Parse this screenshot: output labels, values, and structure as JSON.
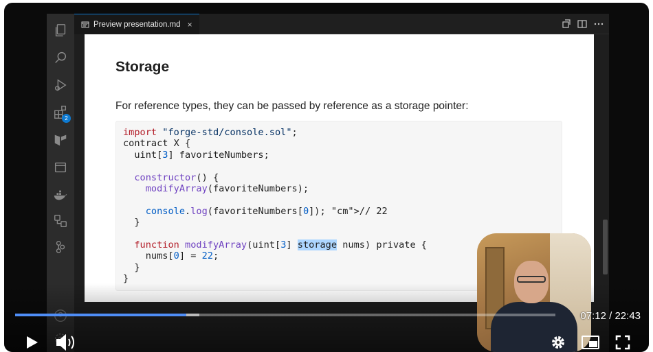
{
  "tab": {
    "title": "Preview presentation.md",
    "close": "×"
  },
  "activity_bar": {
    "extensions_badge": "2"
  },
  "document": {
    "heading": "Storage",
    "paragraph": "For reference types, they can be passed by reference as a storage pointer:"
  },
  "code_lines": [
    "import \"forge-std/console.sol\";",
    "contract X {",
    "  uint[3] favoriteNumbers;",
    "",
    "  constructor() {",
    "    modifyArray(favoriteNumbers);",
    "",
    "    console.log(favoriteNumbers[0]); // 22",
    "  }",
    "",
    "  function modifyArray(uint[3] storage nums) private {",
    "    nums[0] = 22;",
    "  }",
    "}"
  ],
  "player": {
    "current_time": "07:12",
    "duration": "22:43",
    "time_display": "07:12 / 22:43",
    "progress_fraction": 0.317,
    "buffered_fraction": 0.341,
    "accent_color": "#4f8ef7"
  },
  "icons": {
    "activity_bar": [
      "explorer-icon",
      "search-icon",
      "run-debug-icon",
      "extensions-icon",
      "foundry-icon",
      "panel-icon",
      "docker-icon",
      "remote-icon",
      "source-control-icon",
      "account-icon",
      "settings-gear-icon"
    ],
    "controls": [
      "play-icon",
      "volume-icon",
      "settings-icon",
      "picture-in-picture-icon",
      "fullscreen-icon"
    ]
  }
}
